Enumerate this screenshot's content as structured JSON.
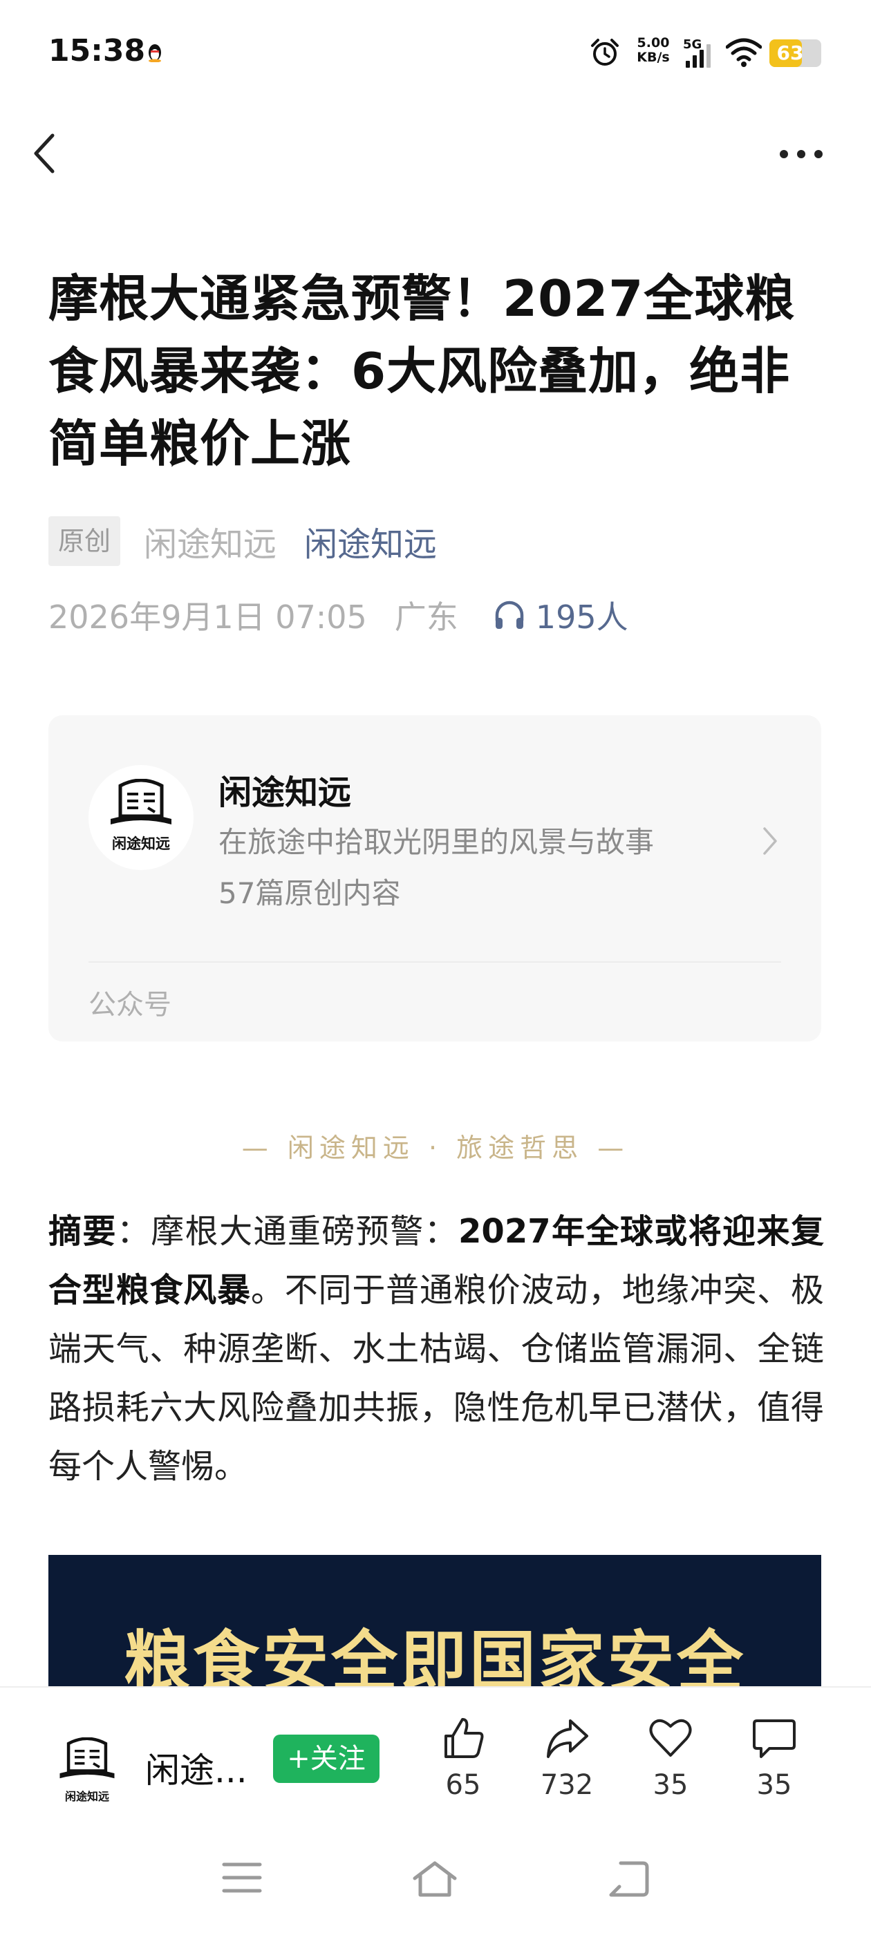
{
  "status_bar": {
    "time": "15:38",
    "net_speed_value": "5.00",
    "net_speed_unit": "KB/s",
    "network_type": "5G",
    "battery_level": "63",
    "battery_fraction": 0.63,
    "battery_color": "#f3c11b"
  },
  "nav": {
    "back_icon": "chevron-left-icon",
    "more_icon": "more-dots-icon"
  },
  "article": {
    "title": "摩根大通紧急预警！2027全球粮食风暴来袭：6大风险叠加，绝非简单粮价上涨",
    "original_tag": "原创",
    "author": "闲途知远",
    "account_link": "闲途知远",
    "datetime": "2026年9月1日 07:05",
    "location": "广东",
    "listeners": "195人"
  },
  "account_card": {
    "avatar_text": "闲途知远",
    "name": "闲途知远",
    "description": "在旅途中拾取光阴里的风景与故事",
    "article_count": "57篇原创内容",
    "type_label": "公众号"
  },
  "series_tag": "— 闲途知远 · 旅途哲思 —",
  "summary": {
    "label": "摘要",
    "intro": "：摩根大通重磅预警：",
    "highlight": "2027年全球或将迎来复合型粮食风暴",
    "body": "。不同于普通粮价波动，地缘冲突、极端天气、种源垄断、水土枯竭、仓储监管漏洞、全链路损耗六大风险叠加共振，隐性危机早已潜伏，值得每个人警惕。"
  },
  "banner": {
    "text": "粮食安全即国家安全"
  },
  "action_bar": {
    "avatar_text": "闲途知远",
    "account_short": "闲途...",
    "follow_label": "+关注",
    "like_count": "65",
    "share_count": "732",
    "favorite_count": "35",
    "comment_count": "35",
    "accent_color": "#1fb35d"
  },
  "system_nav": {
    "menu_icon": "menu-icon",
    "home_icon": "home-icon",
    "back_icon": "back-icon"
  }
}
